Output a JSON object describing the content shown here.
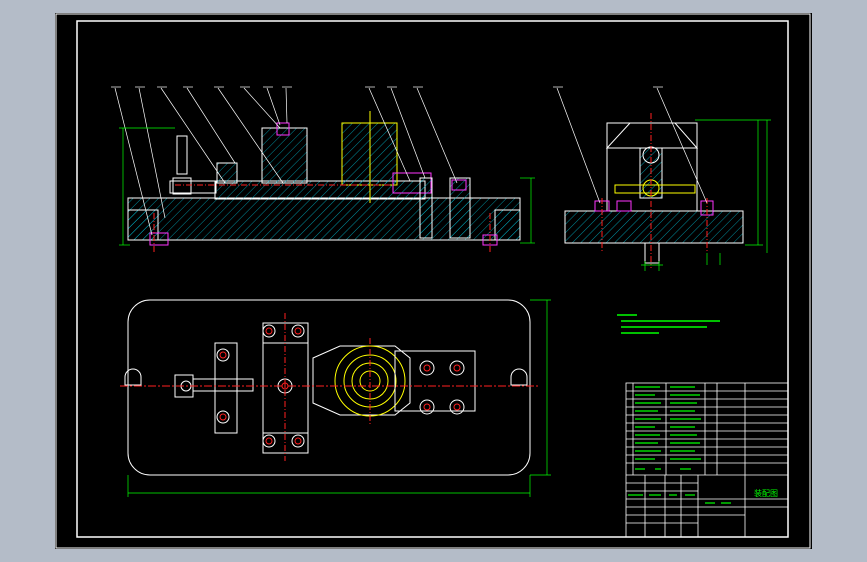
{
  "app": {
    "background_color": "#b4bcc8",
    "canvas_color": "#000000"
  },
  "drawing": {
    "line_colors": {
      "outline": "#ffffff",
      "hatch": "#00b4c8",
      "centerline": "#ff2020",
      "dimension": "#00ff00",
      "hidden_yellow": "#ffff00",
      "fastener": "#ff33ff"
    },
    "title_block": {
      "drawing_title": "装配图"
    }
  }
}
